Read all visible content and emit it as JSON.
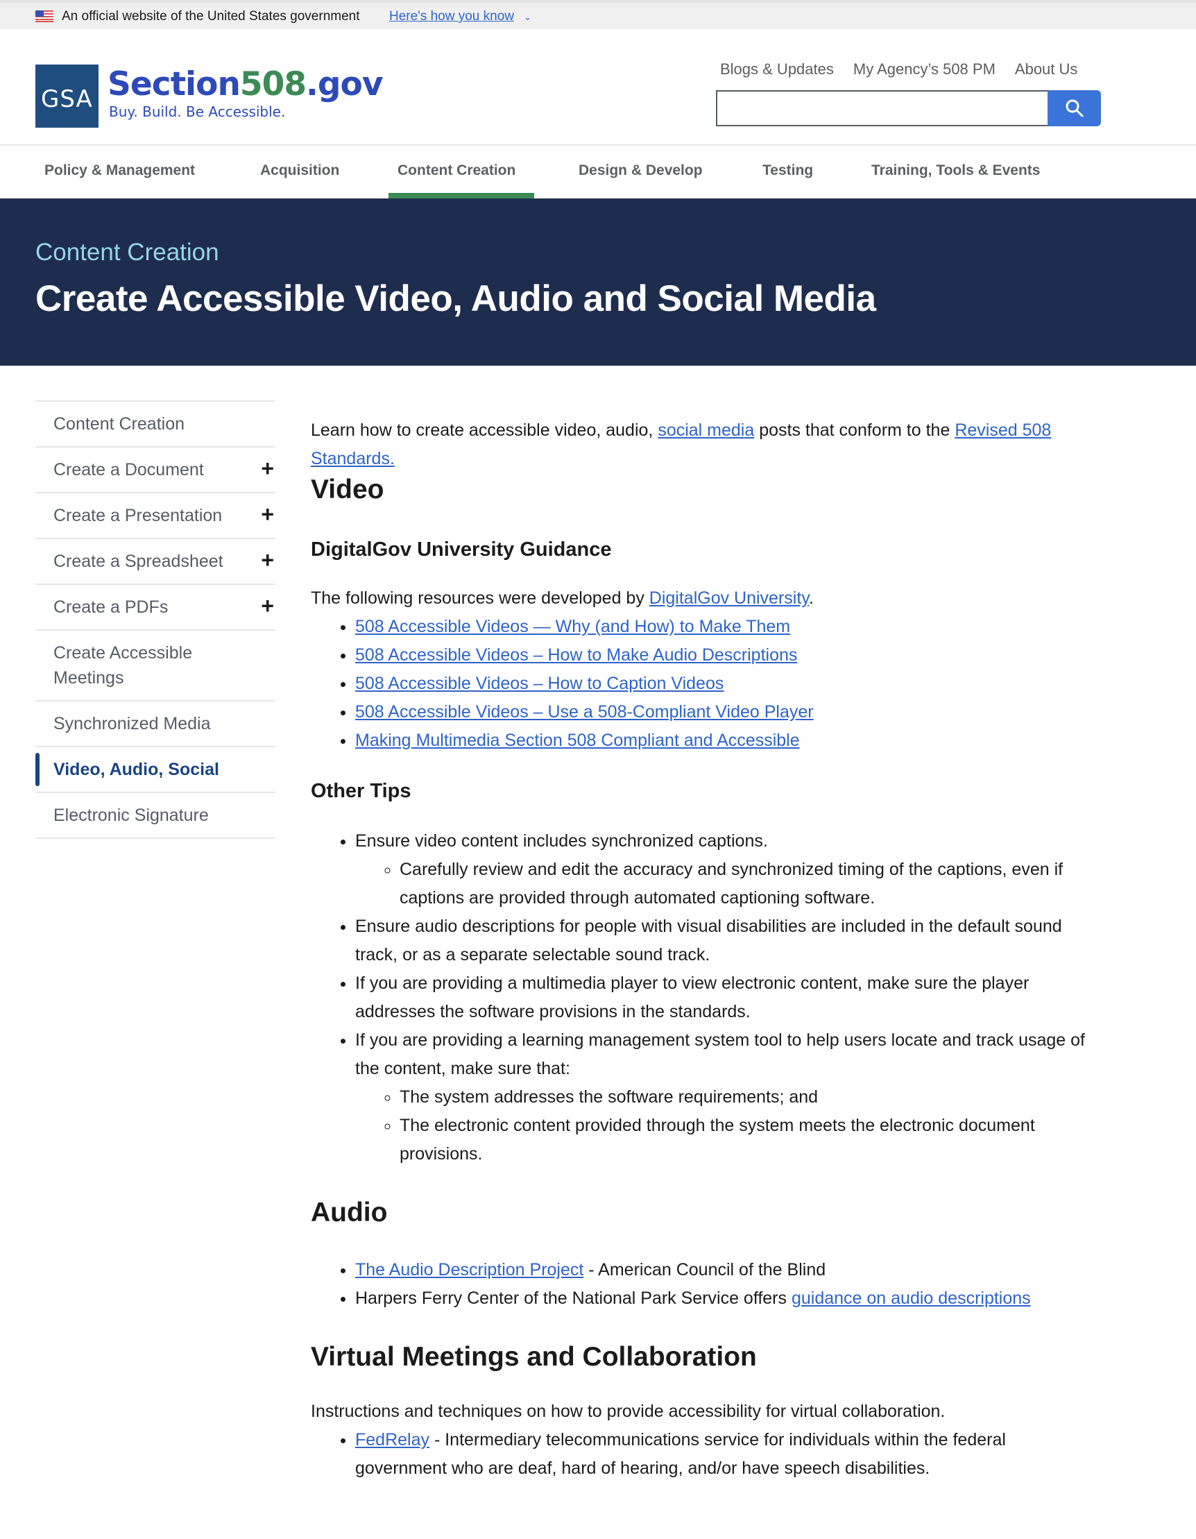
{
  "gov_banner": {
    "official_text": "An official website of the United States government",
    "how_you_know": "Here's how you know",
    "chevron": "⌄"
  },
  "header": {
    "logo_mark": "GSA",
    "site_name_prefix": "Section",
    "site_name_number": "508",
    "site_name_suffix": ".gov",
    "tagline": "Buy. Build. Be Accessible.",
    "utility_links": [
      "Blogs & Updates",
      "My Agency’s 508 PM",
      "About Us"
    ],
    "search": {
      "value": "",
      "placeholder": ""
    }
  },
  "main_nav": {
    "items": [
      {
        "label": "Policy & Management"
      },
      {
        "label": "Acquisition"
      },
      {
        "label": "Content Creation",
        "active": true
      },
      {
        "label": "Design & Develop"
      },
      {
        "label": "Testing"
      },
      {
        "label": "Training, Tools & Events"
      }
    ]
  },
  "hero": {
    "eyebrow": "Content Creation",
    "title": "Create Accessible Video, Audio and Social Media"
  },
  "sidenav": {
    "items": [
      {
        "label": "Content Creation",
        "expandable": false
      },
      {
        "label": "Create a Document",
        "expandable": true
      },
      {
        "label": "Create a Presentation",
        "expandable": true
      },
      {
        "label": "Create a Spreadsheet",
        "expandable": true
      },
      {
        "label": "Create a PDFs",
        "expandable": true
      },
      {
        "label": "Create Accessible Meetings",
        "expandable": false
      },
      {
        "label": "Synchronized Media",
        "expandable": false
      },
      {
        "label": "Video, Audio, Social",
        "expandable": false,
        "current": true
      },
      {
        "label": "Electronic Signature",
        "expandable": false
      }
    ],
    "expand_glyph": "+"
  },
  "content": {
    "intro": {
      "text_before": "Learn how to create accessible video, audio, ",
      "link1": "social media",
      "text_middle": " posts that conform to the ",
      "link2": "Revised 508 Standards."
    },
    "video": {
      "heading": "Video",
      "digitalgov": {
        "heading": "DigitalGov University Guidance",
        "text_before": "The following resources were developed by ",
        "link": "DigitalGov University",
        "text_after": ".",
        "links": [
          "508 Accessible Videos — Why (and How) to Make Them",
          "508 Accessible Videos – How to Make Audio Descriptions",
          "508 Accessible Videos – How to Caption Videos",
          "508 Accessible Videos – Use a 508-Compliant Video Player",
          "Making Multimedia Section 508 Compliant and Accessible"
        ]
      },
      "other_tips": {
        "heading": "Other Tips",
        "items": [
          {
            "text": "Ensure video content includes synchronized captions.",
            "sub": [
              "Carefully review and edit the accuracy and synchronized timing of the captions, even if captions are provided through automated captioning software."
            ]
          },
          {
            "text": "Ensure audio descriptions for people with visual disabilities are included in the default sound track, or as a separate selectable sound track."
          },
          {
            "text": "If you are providing a multimedia player to view electronic content, make sure the player addresses the software provisions in the standards."
          },
          {
            "text": "If you are providing a learning management system tool to help users locate and track usage of the content, make sure that:",
            "sub": [
              "The system addresses the software requirements; and",
              "The electronic content provided through the system meets the electronic document provisions."
            ]
          }
        ]
      }
    },
    "audio": {
      "heading": "Audio",
      "item1": {
        "link": "The Audio Description Project",
        "text": " - American Council of the Blind"
      },
      "item2": {
        "text": "Harpers Ferry Center of the National Park Service offers ",
        "link": "guidance on audio descriptions"
      }
    },
    "virtual": {
      "heading": "Virtual Meetings and Collaboration",
      "intro": "Instructions and techniques on how to provide accessibility for virtual collaboration.",
      "item1": {
        "link": "FedRelay",
        "text": " - Intermediary telecommunications service for individuals within the federal government who are deaf, hard of hearing, and/or have speech disabilities."
      }
    }
  },
  "colors": {
    "link": "#2e63c9",
    "hero_bg": "#1e2d4d",
    "hero_eyebrow": "#97d4ea",
    "nav_active_underline": "#3c8a55",
    "search_button": "#3b74d9",
    "sidenav_current": "#1a4480",
    "logo_blue": "#2d4ab8",
    "logo_green": "#3c8a55"
  }
}
